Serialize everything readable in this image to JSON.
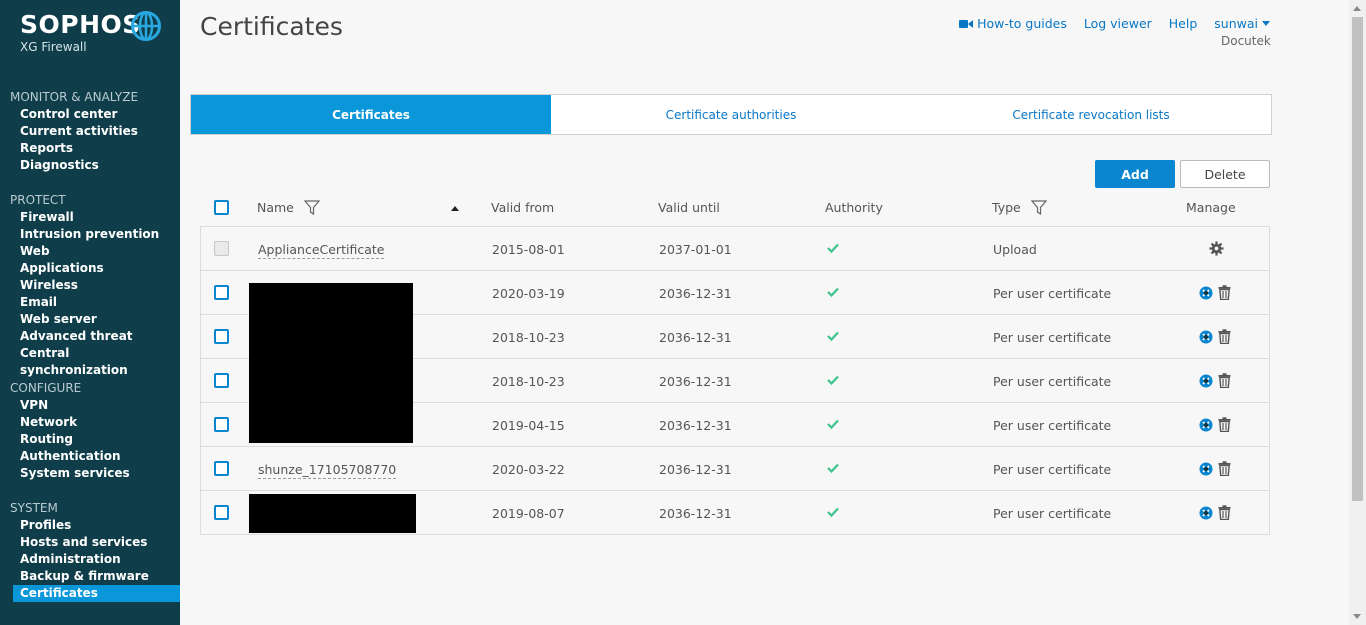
{
  "brand": {
    "name": "SOPHOS",
    "product": "XG Firewall"
  },
  "sidebar": {
    "sections": [
      {
        "title": "MONITOR & ANALYZE",
        "items": [
          "Control center",
          "Current activities",
          "Reports",
          "Diagnostics"
        ]
      },
      {
        "title": "PROTECT",
        "items": [
          "Firewall",
          "Intrusion prevention",
          "Web",
          "Applications",
          "Wireless",
          "Email",
          "Web server",
          "Advanced threat",
          "Central synchronization"
        ]
      },
      {
        "title": "CONFIGURE",
        "items": [
          "VPN",
          "Network",
          "Routing",
          "Authentication",
          "System services"
        ]
      },
      {
        "title": "SYSTEM",
        "items": [
          "Profiles",
          "Hosts and services",
          "Administration",
          "Backup & firmware",
          "Certificates"
        ]
      }
    ],
    "active": "Certificates"
  },
  "header": {
    "title": "Certificates",
    "how_to": "How-to guides",
    "log_viewer": "Log viewer",
    "help": "Help",
    "user": "sunwai",
    "company": "Docutek"
  },
  "tabs": [
    "Certificates",
    "Certificate authorities",
    "Certificate revocation lists"
  ],
  "buttons": {
    "add": "Add",
    "delete": "Delete"
  },
  "table": {
    "columns": {
      "name": "Name",
      "valid_from": "Valid from",
      "valid_until": "Valid until",
      "authority": "Authority",
      "type": "Type",
      "manage": "Manage"
    },
    "rows": [
      {
        "name": "ApplianceCertificate",
        "valid_from": "2015-08-01",
        "valid_until": "2037-01-01",
        "type": "Upload"
      },
      {
        "name": "",
        "valid_from": "2020-03-19",
        "valid_until": "2036-12-31",
        "type": "Per user certificate"
      },
      {
        "name": "",
        "valid_from": "2018-10-23",
        "valid_until": "2036-12-31",
        "type": "Per user certificate"
      },
      {
        "name": "",
        "valid_from": "2018-10-23",
        "valid_until": "2036-12-31",
        "type": "Per user certificate"
      },
      {
        "name": "",
        "valid_from": "2019-04-15",
        "valid_until": "2036-12-31",
        "type": "Per user certificate"
      },
      {
        "name": "shunze_17105708770",
        "valid_from": "2020-03-22",
        "valid_until": "2036-12-31",
        "type": "Per user certificate"
      },
      {
        "name": "",
        "valid_from": "2019-08-07",
        "valid_until": "2036-12-31",
        "type": "Per user certificate"
      }
    ]
  },
  "colors": {
    "sidebar_bg": "#0f3e4a",
    "accent": "#0a97d9",
    "link": "#0a77c5",
    "check": "#3cc48a"
  }
}
